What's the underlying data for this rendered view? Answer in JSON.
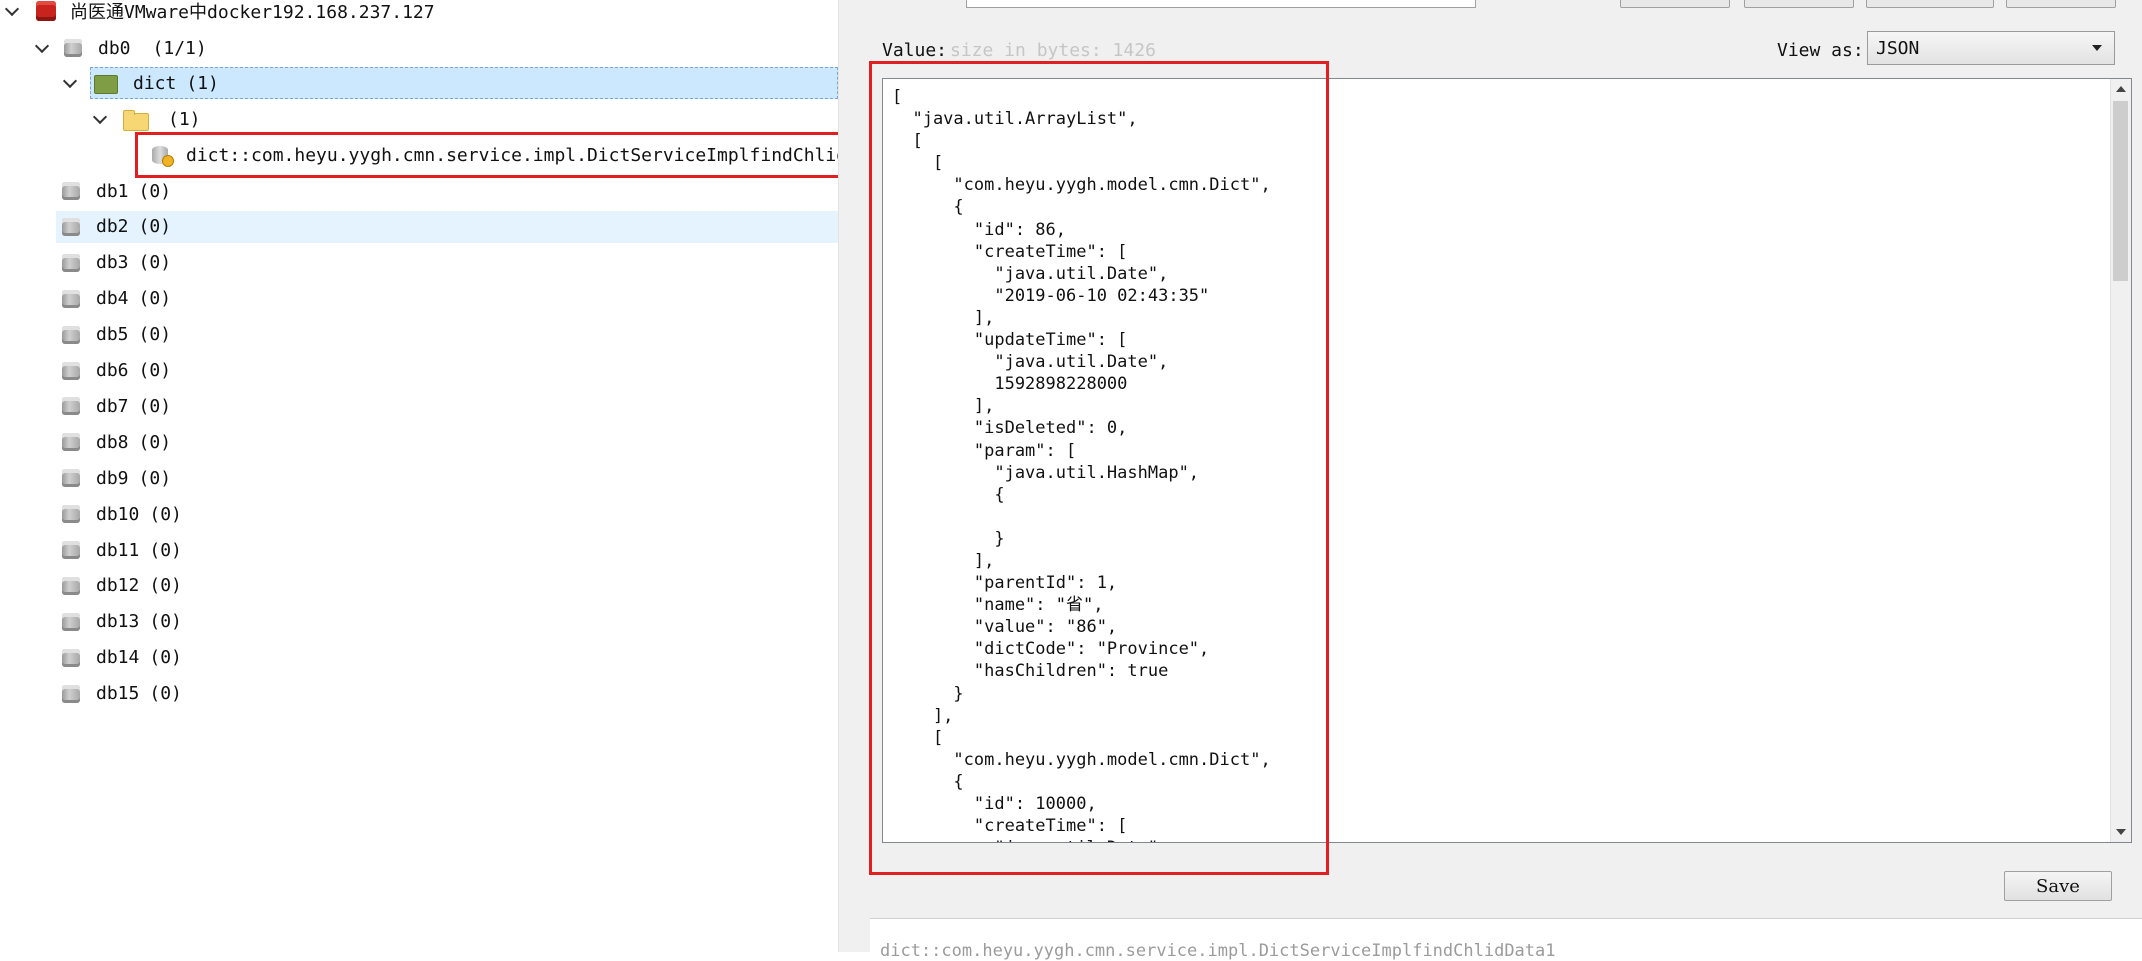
{
  "tree": {
    "connection": "尚医通VMware中docker192.168.237.127",
    "db0": {
      "label": "db0",
      "count": "(1/1)"
    },
    "namespace": {
      "label": "dict",
      "count": "(1)"
    },
    "folder": {
      "label": "",
      "count": "(1)"
    },
    "key": "dict::com.heyu.yygh.cmn.service.impl.DictServiceImplfindChlidData",
    "databases": [
      {
        "label": "db1",
        "count": "(0)"
      },
      {
        "label": "db2",
        "count": "(0)"
      },
      {
        "label": "db3",
        "count": "(0)"
      },
      {
        "label": "db4",
        "count": "(0)"
      },
      {
        "label": "db5",
        "count": "(0)"
      },
      {
        "label": "db6",
        "count": "(0)"
      },
      {
        "label": "db7",
        "count": "(0)"
      },
      {
        "label": "db8",
        "count": "(0)"
      },
      {
        "label": "db9",
        "count": "(0)"
      },
      {
        "label": "db10",
        "count": "(0)"
      },
      {
        "label": "db11",
        "count": "(0)"
      },
      {
        "label": "db12",
        "count": "(0)"
      },
      {
        "label": "db13",
        "count": "(0)"
      },
      {
        "label": "db14",
        "count": "(0)"
      },
      {
        "label": "db15",
        "count": "(0)"
      }
    ]
  },
  "value_panel": {
    "value_label": "Value:",
    "size_placeholder": "size in bytes: 1426",
    "view_as_label": "View as:",
    "view_as_selected": "JSON",
    "editor_lines": [
      "[",
      "  \"java.util.ArrayList\",",
      "  [",
      "    [",
      "      \"com.heyu.yygh.model.cmn.Dict\",",
      "      {",
      "        \"id\": 86,",
      "        \"createTime\": [",
      "          \"java.util.Date\",",
      "          \"2019-06-10 02:43:35\"",
      "        ],",
      "        \"updateTime\": [",
      "          \"java.util.Date\",",
      "          1592898228000",
      "        ],",
      "        \"isDeleted\": 0,",
      "        \"param\": [",
      "          \"java.util.HashMap\",",
      "          {",
      "",
      "          }",
      "        ],",
      "        \"parentId\": 1,",
      "        \"name\": \"省\",",
      "        \"value\": \"86\",",
      "        \"dictCode\": \"Province\",",
      "        \"hasChildren\": true",
      "      }",
      "    ],",
      "    [",
      "      \"com.heyu.yygh.model.cmn.Dict\",",
      "      {",
      "        \"id\": 10000,",
      "        \"createTime\": [",
      "          \"java.util.Date\","
    ],
    "save_label": "Save",
    "bottom_text": "dict::com.heyu.yygh.cmn.service.impl.DictServiceImplfindChlidData1"
  }
}
